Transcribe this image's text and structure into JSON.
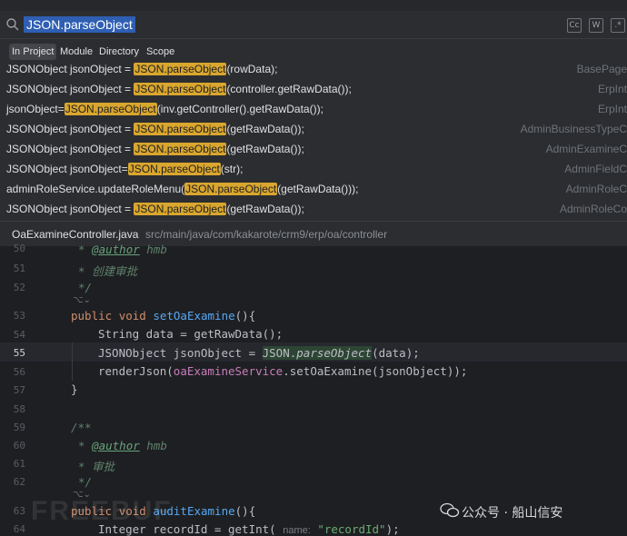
{
  "search": {
    "value": "JSON.parseObject"
  },
  "scope_tabs": [
    {
      "label": "In Project",
      "active": true
    },
    {
      "label": "Module",
      "active": false
    },
    {
      "label": "Directory",
      "active": false
    },
    {
      "label": "Scope",
      "active": false
    }
  ],
  "results": [
    {
      "pre": "JSONObject jsonObject = ",
      "match": "JSON.parseObject",
      "post": "(rowData);",
      "file": "BasePage"
    },
    {
      "pre": "JSONObject jsonObject = ",
      "match": "JSON.parseObject",
      "post": "(controller.getRawData());",
      "file": "ErpInt"
    },
    {
      "pre": "jsonObject=",
      "match": "JSON.parseObject",
      "post": "(inv.getController().getRawData());",
      "file": "ErpInt"
    },
    {
      "pre": "JSONObject jsonObject = ",
      "match": "JSON.parseObject",
      "post": "(getRawData());",
      "file": "AdminBusinessTypeC"
    },
    {
      "pre": "JSONObject jsonObject = ",
      "match": "JSON.parseObject",
      "post": "(getRawData());",
      "file": "AdminExamineC"
    },
    {
      "pre": "JSONObject jsonObject=",
      "match": "JSON.parseObject",
      "post": "(str);",
      "file": "AdminFieldC"
    },
    {
      "pre": "adminRoleService.updateRoleMenu(",
      "match": "JSON.parseObject",
      "post": "(getRawData()));",
      "file": "AdminRoleC"
    },
    {
      "pre": "JSONObject jsonObject = ",
      "match": "JSON.parseObject",
      "post": "(getRawData());",
      "file": "AdminRoleCo"
    }
  ],
  "path": {
    "file": "OaExamineController.java",
    "dir": "src/main/java/com/kakarote/crm9/erp/oa/controller"
  },
  "editor": {
    "line_numbers": [
      "50",
      "51",
      "52",
      "53",
      "54",
      "55",
      "56",
      "57",
      "58",
      "59",
      "60",
      "61",
      "62",
      "63",
      "64"
    ],
    "current_line": "55",
    "author_tag": "@author",
    "author_name": "hmb",
    "comment_create": "创建审批",
    "comment_approve": "审批",
    "doc_open": "/**",
    "doc_close": "*/",
    "kw_public": "public",
    "kw_void": "void",
    "m_set": "setOaExamine",
    "m_audit": "auditExamine",
    "l54": "String data = getRawData();",
    "l55_a": "JSONObject jsonObject = ",
    "l55_cls": "JSON",
    "l55_dot": ".",
    "l55_m": "parseObject",
    "l55_b": "(data);",
    "l56_a": "renderJson(",
    "l56_fld": "oaExamineService",
    "l56_b": ".setOaExamine(jsonObject));",
    "brace_close": "}",
    "l64_a": "Integer recordId = getInt(",
    "l64_hint": "name:",
    "l64_str": "\"recordId\"",
    "l64_b": ");"
  },
  "watermark": {
    "text": "公众号 · 船山信安",
    "brand": "FREEBUF"
  }
}
